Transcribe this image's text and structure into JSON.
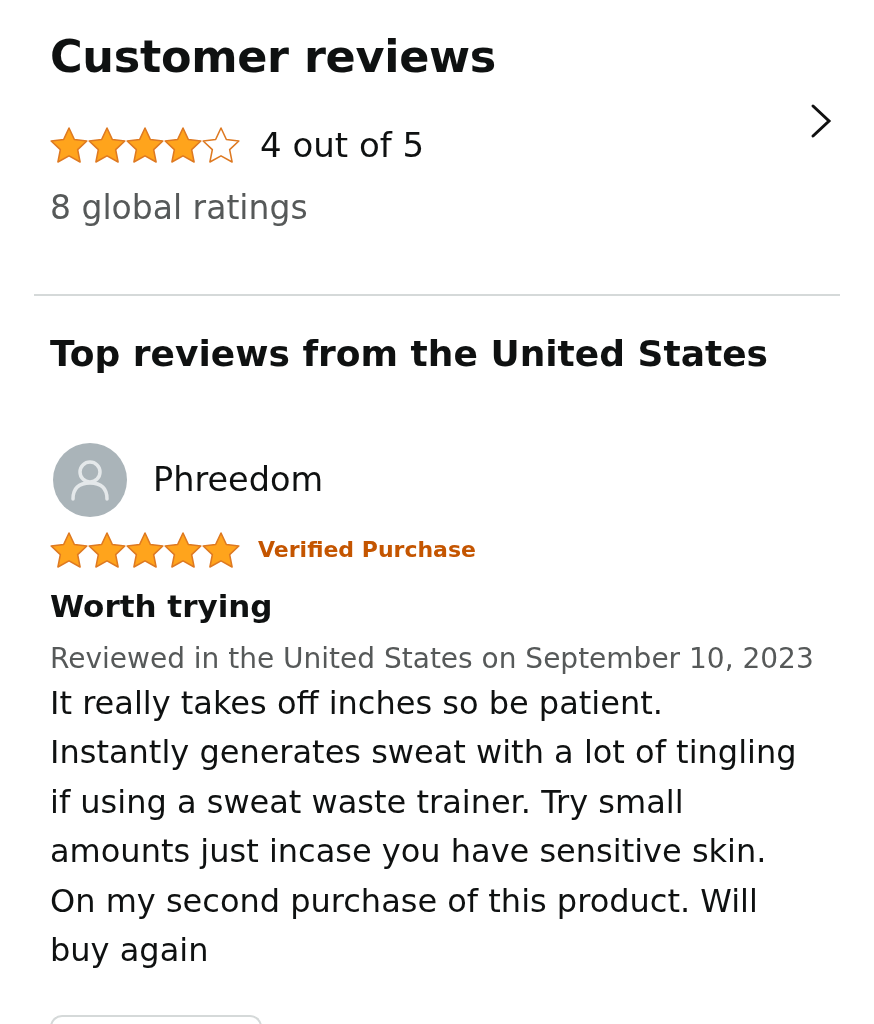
{
  "header": {
    "title": "Customer reviews",
    "stars": 4,
    "rating_text": "4 out of 5",
    "ratings_count": "8 global ratings"
  },
  "top_reviews": {
    "heading": "Top reviews from the United States",
    "reviews": [
      {
        "author": "Phreedom",
        "stars": 5,
        "badge": "Verified Purchase",
        "title": "Worth trying",
        "meta": "Reviewed in the United States on September 10, 2023",
        "body": "It really takes off inches so be patient.\nInstantly generates sweat with a lot of tingling\nif using a sweat waste trainer. Try small\namounts just incase you have sensitive skin.\nOn my second purchase of this product. Will\nbuy again"
      }
    ]
  }
}
